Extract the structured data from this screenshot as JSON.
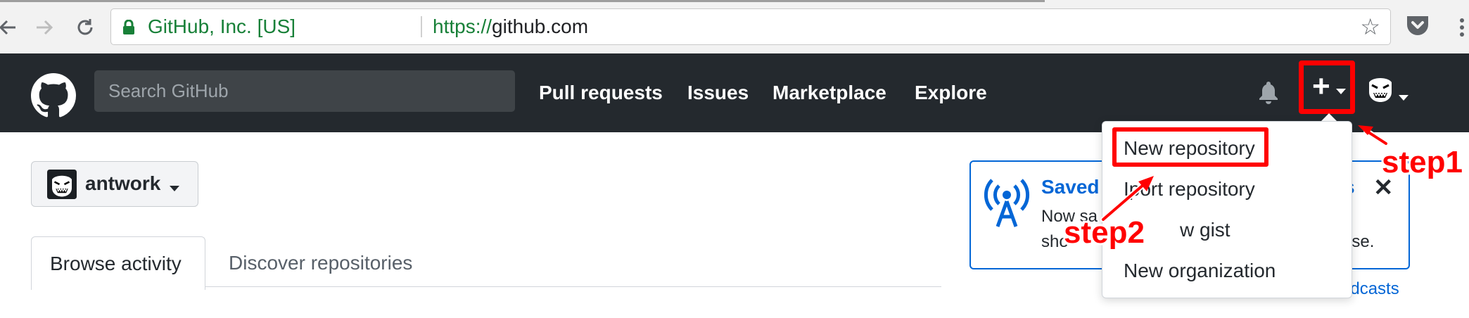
{
  "browser": {
    "site_identity": "GitHub, Inc. [US]",
    "url_scheme": "https://",
    "url_host": "github.com"
  },
  "header": {
    "search_placeholder": "Search GitHub",
    "nav": [
      "Pull requests",
      "Issues",
      "Marketplace",
      "Explore"
    ]
  },
  "context_switcher": {
    "username": "antwork"
  },
  "tabs": {
    "active": "Browse activity",
    "other": "Discover repositories"
  },
  "broadcast": {
    "title_start": "Saved",
    "title_end": "s",
    "line1_start": "Now sa",
    "line2_start": "sho",
    "line2_end": "use.",
    "link_end": "adcasts"
  },
  "create_menu": {
    "items": [
      "New repository",
      "Import repository",
      "New gist",
      "New organization"
    ],
    "item2_start": "I",
    "item2_rest": "port repository",
    "item3_rest": "w gist"
  },
  "annotations": {
    "step1": "step1",
    "step2": "step2"
  },
  "colors": {
    "header_bg": "#24292e",
    "annotation": "#ff0000",
    "link": "#0366d6"
  }
}
